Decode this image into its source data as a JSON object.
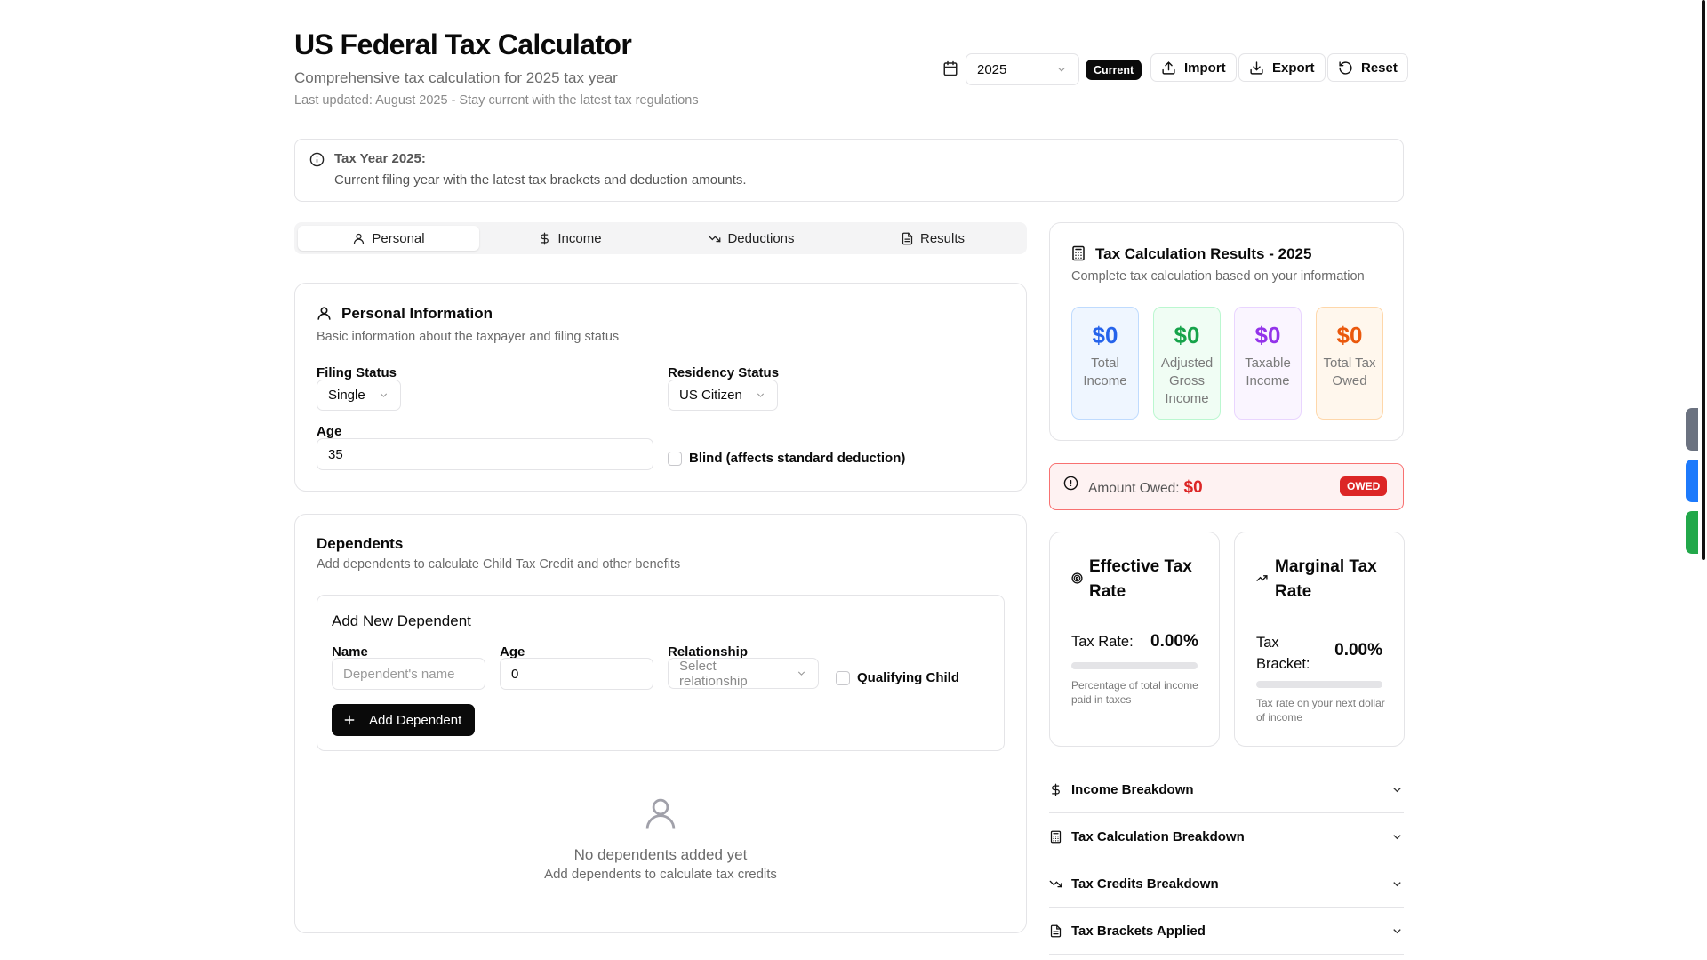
{
  "header": {
    "title": "US Federal Tax Calculator",
    "subtitle": "Comprehensive tax calculation for 2025 tax year",
    "updated": "Last updated: August 2025 - Stay current with the latest tax regulations",
    "year_value": "2025",
    "current_badge": "Current",
    "import_label": "Import",
    "export_label": "Export",
    "reset_label": "Reset"
  },
  "banner": {
    "title": "Tax Year 2025:",
    "text": "Current filing year with the latest tax brackets and deduction amounts."
  },
  "tabs": [
    {
      "label": "Personal",
      "icon": "user-icon",
      "active": true
    },
    {
      "label": "Income",
      "icon": "dollar-icon",
      "active": false
    },
    {
      "label": "Deductions",
      "icon": "trending-down-icon",
      "active": false
    },
    {
      "label": "Results",
      "icon": "file-text-icon",
      "active": false
    }
  ],
  "personal": {
    "title": "Personal Information",
    "description": "Basic information about the taxpayer and filing status",
    "filing_status_label": "Filing Status",
    "filing_status_value": "Single",
    "residency_label": "Residency Status",
    "residency_value": "US Citizen",
    "age_label": "Age",
    "age_value": "35",
    "blind_label": "Blind (affects standard deduction)"
  },
  "dependents": {
    "title": "Dependents",
    "description": "Add dependents to calculate Child Tax Credit and other benefits",
    "add_title": "Add New Dependent",
    "name_label": "Name",
    "name_placeholder": "Dependent's name",
    "age_label": "Age",
    "age_value": "0",
    "relationship_label": "Relationship",
    "relationship_placeholder": "Select relationship",
    "qualifying_label": "Qualifying Child",
    "add_button": "Add Dependent",
    "empty_title": "No dependents added yet",
    "empty_text": "Add dependents to calculate tax credits"
  },
  "results": {
    "title": "Tax Calculation Results - 2025",
    "description": "Complete tax calculation based on your information",
    "stats": [
      {
        "value": "$0",
        "label": "Total Income",
        "color": "#2563eb",
        "bg": "#eff6ff",
        "border": "#bfdbfe"
      },
      {
        "value": "$0",
        "label": "Adjusted Gross Income",
        "color": "#16a34a",
        "bg": "#f0fdf4",
        "border": "#bbf7d0"
      },
      {
        "value": "$0",
        "label": "Taxable Income",
        "color": "#9333ea",
        "bg": "#faf5ff",
        "border": "#e9d5ff"
      },
      {
        "value": "$0",
        "label": "Total Tax Owed",
        "color": "#ea580c",
        "bg": "#fff7ed",
        "border": "#fed7aa"
      }
    ],
    "owed_label": "Amount Owed:",
    "owed_value": "$0",
    "owed_badge": "OWED"
  },
  "effective": {
    "title": "Effective Tax Rate",
    "rate_label": "Tax Rate:",
    "rate_value": "0.00%",
    "rate_fraction": 0,
    "note": "Percentage of total income paid in taxes"
  },
  "marginal": {
    "title": "Marginal Tax Rate",
    "rate_label": "Tax Bracket:",
    "rate_value": "0.00%",
    "rate_fraction": 0,
    "note": "Tax rate on your next dollar of income"
  },
  "accordion": [
    {
      "label": "Income Breakdown",
      "icon": "dollar-icon"
    },
    {
      "label": "Tax Calculation Breakdown",
      "icon": "calculator-icon"
    },
    {
      "label": "Tax Credits Breakdown",
      "icon": "trending-down-icon"
    },
    {
      "label": "Tax Brackets Applied",
      "icon": "file-text-icon"
    }
  ],
  "colors": {
    "primary": "#0a0a0a",
    "owed_red": "#dc2626",
    "border": "#e4e4e7"
  }
}
